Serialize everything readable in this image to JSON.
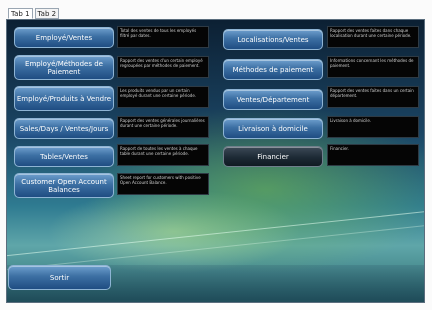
{
  "tabs": [
    {
      "label": "Tab 1"
    },
    {
      "label": "Tab 2"
    }
  ],
  "left_column": [
    {
      "label": "Employé/Ventes",
      "desc": "Total des ventes de tous les employés filtré par dates."
    },
    {
      "label": "Employé/Méthodes de Paiement",
      "desc": "Rapport des ventes d'un certain employé regroupées par méthodes de paiement."
    },
    {
      "label": "Employé/Produits à Vendre",
      "desc": "Les produits vendus par un certain employé durant une certaine période."
    },
    {
      "label": "Sales/Days / Ventes/Jours",
      "desc": "Rapport des ventes générales journalières durant une certaine période."
    },
    {
      "label": "Tables/Ventes",
      "desc": "Rapport de toutes les ventes à chaque table durant une certaine période."
    },
    {
      "label": "Customer Open Account Balances",
      "desc": "Sheet report for customers with positive Open Account Balance."
    }
  ],
  "right_column": [
    {
      "label": "Localisations/Ventes",
      "desc": "Rapport des ventes faites dans chaque localisation durant une certaine période."
    },
    {
      "label": "Méthodes de paiement",
      "desc": "Informations concernant les méthodes de paiement."
    },
    {
      "label": "Ventes/Département",
      "desc": "Rapport des ventes faites dans un certain département."
    },
    {
      "label": "Livraison à domicile",
      "desc": "Livraison à domicile."
    },
    {
      "label": "Financier",
      "desc": "Financier."
    }
  ],
  "footer": {
    "exit_label": "Sortir"
  }
}
